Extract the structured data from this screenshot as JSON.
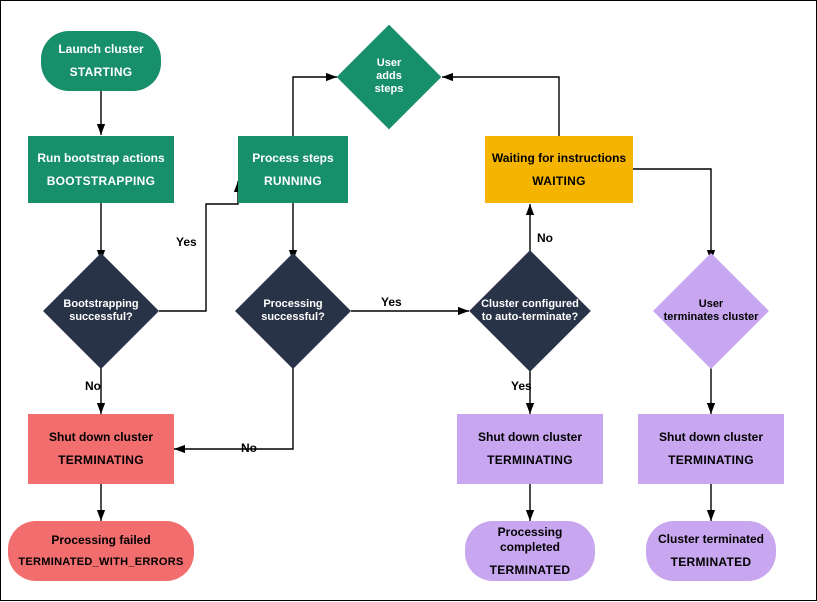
{
  "nodes": {
    "start": {
      "line1": "Launch cluster",
      "line2": "STARTING",
      "color": "green",
      "shape": "pill"
    },
    "bootstrap": {
      "line1": "Run bootstrap actions",
      "line2": "BOOTSTRAPPING",
      "color": "green",
      "shape": "rect"
    },
    "process": {
      "line1": "Process steps",
      "line2": "RUNNING",
      "color": "green",
      "shape": "rect"
    },
    "waiting": {
      "line1": "Waiting for instructions",
      "line2": "WAITING",
      "color": "amber",
      "shape": "rect"
    },
    "userAdds": {
      "line1": "User\nadds\nsteps",
      "color": "green",
      "shape": "diamond"
    },
    "bootQ": {
      "line1": "Bootstrapping\nsuccessful?",
      "color": "dark",
      "shape": "diamond"
    },
    "procQ": {
      "line1": "Processing\nsuccessful?",
      "color": "dark",
      "shape": "diamond"
    },
    "autoQ": {
      "line1": "Cluster configured\nto auto-terminate?",
      "color": "dark",
      "shape": "diamond"
    },
    "userTerm": {
      "line1": "User\nterminates cluster",
      "color": "lilac",
      "shape": "diamond"
    },
    "termFail": {
      "line1": "Shut down cluster",
      "line2": "TERMINATING",
      "color": "red",
      "shape": "rect"
    },
    "termOk": {
      "line1": "Shut down cluster",
      "line2": "TERMINATING",
      "color": "lilac",
      "shape": "rect"
    },
    "termUser": {
      "line1": "Shut down cluster",
      "line2": "TERMINATING",
      "color": "lilac",
      "shape": "rect"
    },
    "finFail": {
      "line1": "Processing failed",
      "line2": "TERMINATED_WITH_ERRORS",
      "color": "red",
      "shape": "pill"
    },
    "finOk": {
      "line1": "Processing completed",
      "line2": "TERMINATED",
      "color": "lilac",
      "shape": "pill"
    },
    "finUser": {
      "line1": "Cluster terminated",
      "line2": "TERMINATED",
      "color": "lilac",
      "shape": "pill"
    }
  },
  "edgeLabels": {
    "bootYes": "Yes",
    "bootNo": "No",
    "procYes": "Yes",
    "procNo": "No",
    "autoYes": "Yes",
    "autoNo": "No"
  }
}
